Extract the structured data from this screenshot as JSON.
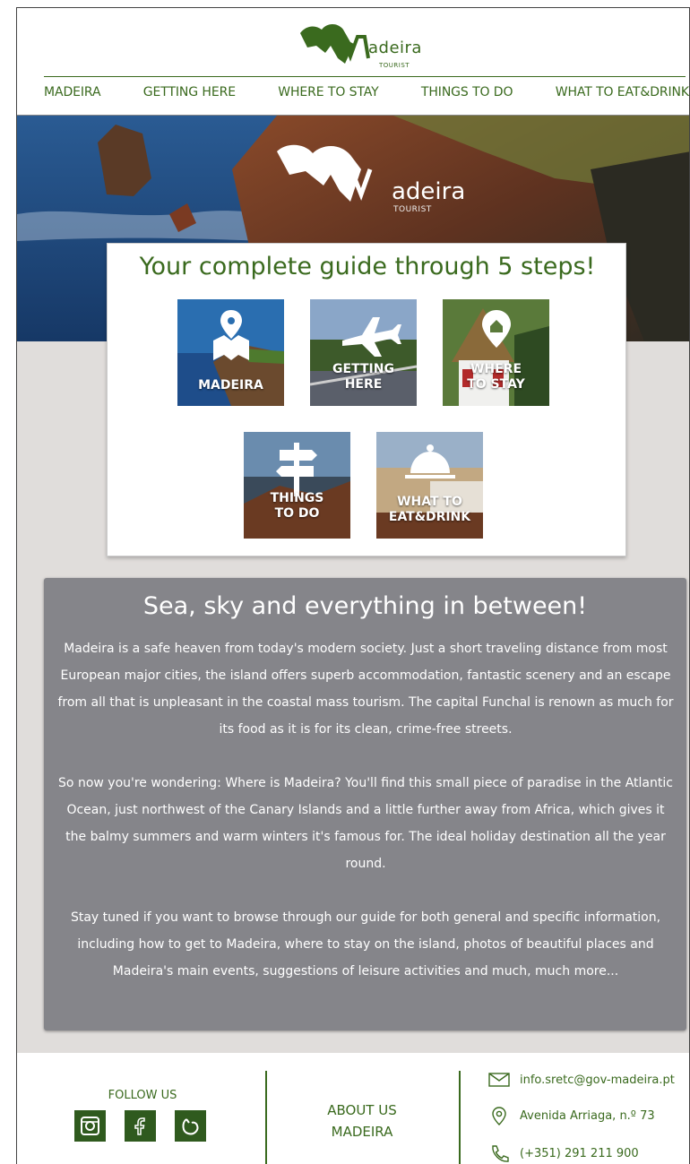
{
  "brand": {
    "name": "adeira",
    "sub": "TOURIST",
    "green": "#3a6a1e"
  },
  "nav": {
    "items": [
      "MADEIRA",
      "GETTING HERE",
      "WHERE TO STAY",
      "THINGS TO DO",
      "WHAT TO EAT&DRINK"
    ]
  },
  "hero": {
    "logo_word": "adeira",
    "logo_sub": "TOURIST"
  },
  "guide": {
    "title": "Your complete guide through 5 steps!",
    "tiles": [
      {
        "label": "MADEIRA",
        "icon": "map-pin-icon"
      },
      {
        "label": "GETTING\nHERE",
        "icon": "airplane-icon"
      },
      {
        "label": "WHERE\nTO STAY",
        "icon": "house-pin-icon"
      },
      {
        "label": "THINGS\nTO DO",
        "icon": "signpost-icon"
      },
      {
        "label": "WHAT TO\nEAT&DRINK",
        "icon": "cloche-icon"
      }
    ]
  },
  "about": {
    "title": "Sea, sky and everything in between!",
    "paragraphs": [
      "Madeira is a safe heaven from today's modern society. Just a short traveling distance from most European major cities, the island offers superb accommodation, fantastic scenery and an escape from all that is unpleasant in the coastal mass tourism. The capital Funchal is renown as much for its food as it is for its clean, crime-free streets.",
      "So now you're wondering: Where is Madeira? You'll find this small piece of paradise in the Atlantic Ocean, just northwest of the Canary Islands and a little further away from Africa, which gives it the balmy summers and warm winters it's famous for. The ideal holiday destination all the year round.",
      "Stay tuned if you want to browse through our guide for both general and specific information, including how to get to Madeira, where to stay on the island, photos of beautiful places and Madeira's main events, suggestions of leisure activities and much, much more..."
    ]
  },
  "footer": {
    "follow_label": "FOLLOW US",
    "social": [
      "instagram-icon",
      "facebook-icon",
      "tripadvisor-icon"
    ],
    "about_line1": "ABOUT US",
    "about_line2": "MADEIRA",
    "email": "info.sretc@gov-madeira.pt",
    "address": "Avenida Arriaga, n.º 73",
    "phone": "(+351) 291 211 900"
  }
}
